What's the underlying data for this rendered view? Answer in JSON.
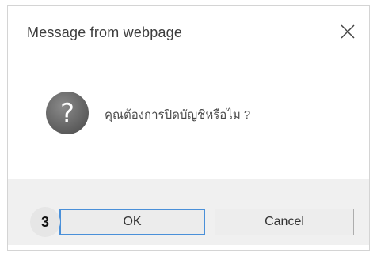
{
  "dialog": {
    "title": "Message from webpage",
    "message": "คุณต้องการปิดบัญชีหรือไม ?",
    "icon": "question-icon",
    "close_icon": "close-icon"
  },
  "buttons": {
    "ok_label": "OK",
    "cancel_label": "Cancel"
  },
  "annotation": {
    "step_number": "3"
  },
  "colors": {
    "icon_fill": "#6b6b6b",
    "ok_border": "#4a90d9",
    "footer_bg": "#f0f0f0"
  }
}
